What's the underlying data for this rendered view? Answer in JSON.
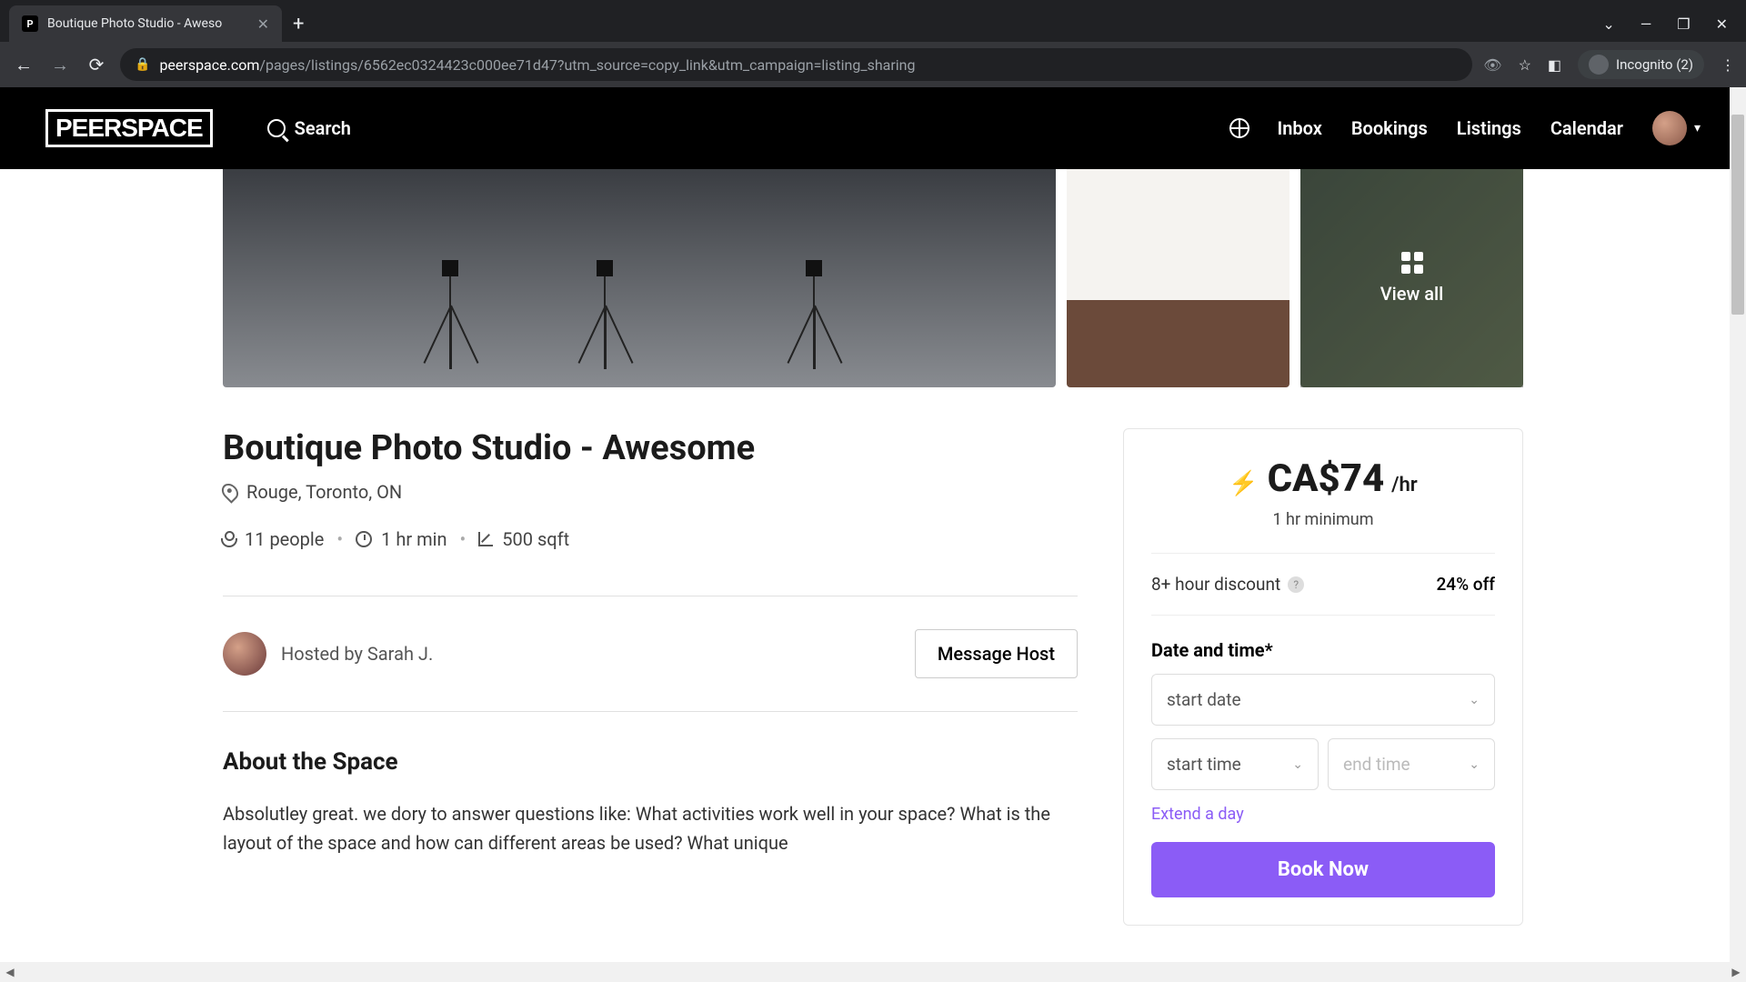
{
  "browser": {
    "tab_title": "Boutique Photo Studio - Aweso",
    "favicon_letter": "P",
    "url_domain": "peerspace.com",
    "url_path": "/pages/listings/6562ec0324423c000ee71d47?utm_source=copy_link&utm_campaign=listing_sharing",
    "incognito_label": "Incognito (2)"
  },
  "header": {
    "logo": "PEERSPACE",
    "search": "Search",
    "nav": {
      "inbox": "Inbox",
      "bookings": "Bookings",
      "listings": "Listings",
      "calendar": "Calendar"
    }
  },
  "gallery": {
    "view_all": "View all"
  },
  "listing": {
    "title": "Boutique Photo Studio - Awesome",
    "location": "Rouge, Toronto, ON",
    "capacity": "11 people",
    "min_duration": "1 hr min",
    "area": "500 sqft",
    "host_label": "Hosted by Sarah J.",
    "message_host": "Message Host",
    "about_heading": "About the Space",
    "about_body": "Absolutley great. we dory to answer questions like: What activities work well in your space? What is the layout of the space and how can different areas be used? What unique"
  },
  "booking": {
    "price": "CA$74",
    "price_unit": "/hr",
    "minimum": "1 hr minimum",
    "discount_label": "8+ hour discount",
    "discount_amount": "24% off",
    "date_label": "Date and time*",
    "start_date": "start date",
    "start_time": "start time",
    "end_time": "end time",
    "extend": "Extend a day",
    "book": "Book Now"
  }
}
